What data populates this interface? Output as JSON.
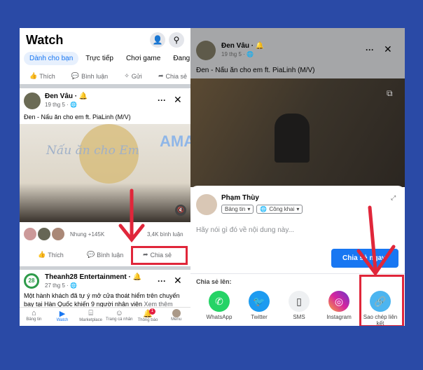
{
  "left": {
    "title": "Watch",
    "tabs": [
      "Dành cho bạn",
      "Trực tiếp",
      "Chơi game",
      "Đang th"
    ],
    "top_actions": [
      "Thích",
      "Bình luận",
      "Gửi",
      "Chia sẻ"
    ],
    "post": {
      "author": "Đen Vâu",
      "date": "19 thg 5",
      "caption": "Đen - Nấu ăn cho em ft. PiaLinh (M/V)",
      "reactions": "Nhung +145K",
      "comments": "3,4K bình luận",
      "actions": [
        "Thích",
        "Bình luận",
        "Chia sẻ"
      ],
      "video_watermark": "Nấu ăn cho Em"
    },
    "post2": {
      "author": "Theanh28 Entertainment",
      "date": "27 thg 5",
      "caption_line1": "Một hành khách đã tự ý mở cửa thoát hiểm trên chuyến",
      "caption_line2": "bay tại Hàn Quốc khiến 9 người nhân viên",
      "see_more": "Xem thêm"
    },
    "nav": [
      {
        "label": "Bảng tin",
        "icon": "home-icon"
      },
      {
        "label": "Watch",
        "icon": "play-icon"
      },
      {
        "label": "Marketplace",
        "icon": "store-icon"
      },
      {
        "label": "Trang cá nhân",
        "icon": "profile-icon"
      },
      {
        "label": "Thông báo",
        "icon": "bell-icon",
        "badge": "1"
      },
      {
        "label": "Menu",
        "icon": "avatar"
      }
    ]
  },
  "right": {
    "post": {
      "author": "Đen Vâu",
      "date": "19 thg 5",
      "caption": "Đen - Nấu ăn cho em ft. PiaLinh (M/V)"
    },
    "sheet": {
      "user": "Phạm Thùy",
      "audience": "Bảng tin",
      "privacy": "Công khai",
      "placeholder": "Hãy nói gì đó về nội dung này...",
      "share_now": "Chia sẻ ngay",
      "share_to": "Chia sẻ lên:",
      "targets": [
        {
          "label": "WhatsApp",
          "color": "#25d366"
        },
        {
          "label": "Twitter",
          "color": "#1d9bf0"
        },
        {
          "label": "SMS",
          "color": "#e4e6eb"
        },
        {
          "label": "Instagram",
          "color": "#d6249f"
        },
        {
          "label": "Sao chép liên kết",
          "color": "#4cb5f0"
        }
      ]
    }
  },
  "watermark": "AMAILINK RÚT GỌN LINK QUẢN LÝ",
  "colors": {
    "background": "#2a4aa6",
    "accent": "#1877f2",
    "highlight": "#e0263a"
  }
}
